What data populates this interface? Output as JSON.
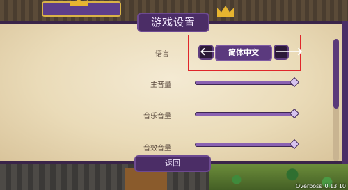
{
  "title": "游戏设置",
  "settings": {
    "language": {
      "label": "语言",
      "value": "简体中文",
      "prev_icon": "arrow-left-icon",
      "next_icon": "arrow-right-icon",
      "prev_glyph": "🡐",
      "next_glyph": "🡒"
    },
    "master_volume": {
      "label": "主音量",
      "level": 1.0
    },
    "music_volume": {
      "label": "音乐音量",
      "level": 1.0
    },
    "sfx_volume": {
      "label": "音效音量",
      "level": 1.0
    }
  },
  "buttons": {
    "back_label": "返回"
  },
  "version": "Overboss_0.13.10",
  "colors": {
    "panel_purple": "#4b2d66",
    "highlight_red": "#e0262a",
    "parchment": "#eadbb8"
  }
}
